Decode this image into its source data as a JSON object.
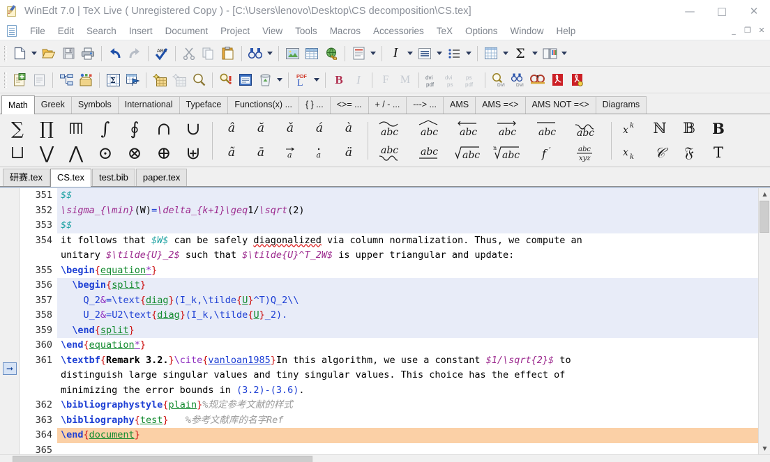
{
  "window": {
    "title": "WinEdt 7.0 | TeX Live  ( Unregistered  Copy )  - [C:\\Users\\lenovo\\Desktop\\CS decomposition\\CS.tex]",
    "app_icon": "winedt-notepad-pencil-icon",
    "minimize": "—",
    "maximize": "□",
    "close": "✕",
    "mdi_minimize": "_",
    "mdi_restore": "❐",
    "mdi_close": "✕"
  },
  "menubar": {
    "doc_icon": "document-icon",
    "items": [
      "File",
      "Edit",
      "Search",
      "Insert",
      "Document",
      "Project",
      "View",
      "Tools",
      "Macros",
      "Accessories",
      "TeX",
      "Options",
      "Window",
      "Help"
    ]
  },
  "toolbar1": [
    {
      "name": "new-document-button",
      "icon": "new-page-icon"
    },
    {
      "name": "new-document-dropdown",
      "icon": "chevron-down-icon"
    },
    {
      "name": "open-button",
      "icon": "open-folder-icon"
    },
    {
      "name": "save-button",
      "icon": "floppy-disk-icon"
    },
    {
      "name": "print-button",
      "icon": "printer-icon"
    },
    {
      "name": "undo-button",
      "icon": "undo-arrow-icon"
    },
    {
      "name": "redo-button",
      "icon": "redo-arrow-icon"
    },
    {
      "name": "spellcheck-button",
      "icon": "abc-check-icon"
    },
    {
      "name": "cut-button",
      "icon": "scissors-icon"
    },
    {
      "name": "copy-button",
      "icon": "copy-pages-icon"
    },
    {
      "name": "paste-button",
      "icon": "clipboard-paste-icon"
    },
    {
      "name": "find-button",
      "icon": "binoculars-icon"
    },
    {
      "name": "find-dropdown",
      "icon": "chevron-down-icon"
    },
    {
      "name": "insert-image-button",
      "icon": "picture-icon"
    },
    {
      "name": "insert-table-button",
      "icon": "table-grid-icon"
    },
    {
      "name": "insert-url-button",
      "icon": "globe-link-icon"
    },
    {
      "name": "document-template-button",
      "icon": "document-red-icon"
    },
    {
      "name": "document-template-dropdown",
      "icon": "chevron-down-icon"
    },
    {
      "name": "italic-button",
      "icon": "italic-I-icon"
    },
    {
      "name": "italic-dropdown",
      "icon": "chevron-down-icon"
    },
    {
      "name": "align-button",
      "icon": "align-paragraph-icon"
    },
    {
      "name": "align-dropdown",
      "icon": "chevron-down-icon"
    },
    {
      "name": "list-button",
      "icon": "bullet-list-icon"
    },
    {
      "name": "list-dropdown",
      "icon": "chevron-down-icon"
    },
    {
      "name": "tabular-button",
      "icon": "tabular-grid-icon"
    },
    {
      "name": "tabular-dropdown",
      "icon": "chevron-down-icon"
    },
    {
      "name": "math-sigma-button",
      "icon": "sigma-icon"
    },
    {
      "name": "math-sigma-dropdown",
      "icon": "chevron-down-icon"
    },
    {
      "name": "book-button",
      "icon": "open-book-icon"
    },
    {
      "name": "book-dropdown",
      "icon": "chevron-down-icon"
    }
  ],
  "toolbar2": [
    {
      "name": "project-open-button",
      "icon": "project-green-plus-icon"
    },
    {
      "name": "project-close-button",
      "icon": "project-gray-icon"
    },
    {
      "name": "tree-structure-button",
      "icon": "tree-nodes-icon"
    },
    {
      "name": "package-button",
      "icon": "toolbox-icon"
    },
    {
      "name": "latex-matrix-button",
      "icon": "sigma-grid-icon"
    },
    {
      "name": "latex-wizard-button",
      "icon": "grid-flag-icon"
    },
    {
      "name": "build-button",
      "icon": "sparkle-grid-icon"
    },
    {
      "name": "build-gray-button",
      "icon": "gray-grid-icon"
    },
    {
      "name": "preview-button",
      "icon": "magnifier-icon"
    },
    {
      "name": "error-find-button",
      "icon": "magnifier-exclaim-icon"
    },
    {
      "name": "console-button",
      "icon": "blue-window-icon"
    },
    {
      "name": "cleanup-button",
      "icon": "trash-recycle-icon"
    },
    {
      "name": "cleanup-dropdown",
      "icon": "chevron-down-icon"
    },
    {
      "name": "pdflatex-button",
      "icon": "pdf-L-icon"
    },
    {
      "name": "pdflatex-dropdown",
      "icon": "chevron-down-icon"
    },
    {
      "name": "bibtex-button",
      "icon": "bold-B-icon"
    },
    {
      "name": "makeindex-button",
      "icon": "italic-I-gray-icon"
    },
    {
      "name": "f-button",
      "icon": "F-gray-icon"
    },
    {
      "name": "m-button",
      "icon": "M-gray-icon"
    },
    {
      "name": "dvi-pdf-button",
      "icon": "dvi-pdf-icon"
    },
    {
      "name": "dvi-ps-button",
      "icon": "dvi-ps-icon"
    },
    {
      "name": "ps-pdf-button",
      "icon": "ps-pdf-icon"
    },
    {
      "name": "preview-dvi-button",
      "icon": "magnifier-dvi-icon"
    },
    {
      "name": "search-dvi-button",
      "icon": "binoculars-dvi-icon"
    },
    {
      "name": "ghostview-button",
      "icon": "ghostscript-icon"
    },
    {
      "name": "acrobat-button",
      "icon": "acrobat-red-icon"
    },
    {
      "name": "acrobat2-button",
      "icon": "acrobat-red-2-icon"
    }
  ],
  "math_tabs": {
    "active": "Math",
    "items": [
      "Math",
      "Greek",
      "Symbols",
      "International",
      "Typeface",
      "Functions(x)  ...",
      "{ }  ...",
      "<>=  ...",
      "+ / -  ...",
      "--->  ...",
      "AMS",
      "AMS  =<>",
      "AMS NOT =<>",
      "Diagrams"
    ]
  },
  "palette": {
    "group1_row1": [
      "∑",
      "∏",
      "⨆",
      "∫",
      "∮",
      "∩",
      "∪"
    ],
    "group1_row2": [
      "⨆",
      "⋁",
      "⋀",
      "⊙",
      "⊗",
      "⊕",
      "⊎"
    ],
    "group1_row1_names": [
      "sum-icon",
      "prod-icon",
      "coprod-icon",
      "int-icon",
      "oint-icon",
      "cap-icon",
      "cup-icon"
    ],
    "group1_row2_names": [
      "bigsqcup-icon",
      "vee-icon",
      "wedge-icon",
      "odot-icon",
      "otimes-icon",
      "oplus-icon",
      "uplus-icon"
    ],
    "group2_row1": [
      "â",
      "ă",
      "ǎ",
      "á",
      "à"
    ],
    "group2_row2": [
      "ã",
      "ā",
      "⃗a",
      "ȧ",
      "ä"
    ],
    "group2_row1_names": [
      "hat-a-icon",
      "breve-a-icon",
      "check-a-icon",
      "acute-a-icon",
      "grave-a-icon"
    ],
    "group2_row2_names": [
      "tilde-a-icon",
      "bar-a-icon",
      "vec-a-icon",
      "dot-a-icon",
      "ddot-a-icon"
    ],
    "group3_row1_names": [
      "widetilde-abc-icon",
      "widehat-abc-icon",
      "overleftarrow-abc-icon",
      "overrightarrow-abc-icon",
      "overline-abc-icon",
      "overbrace-abc-icon"
    ],
    "group3_row2_names": [
      "underbrace-abc-icon",
      "underline-abc-icon",
      "sqrt-abc-icon",
      "nthroot-abc-icon",
      "prime-f-icon",
      "frac-abc-xyz-icon"
    ],
    "group3_row1_labels": [
      "abc",
      "abc",
      "abc",
      "abc",
      "abc",
      "abc"
    ],
    "group3_row2_labels": [
      "abc",
      "abc",
      "abc",
      "abc",
      "f′",
      "abc/xyz"
    ],
    "group4_row1": [
      "xᵏ",
      "ℕ",
      "𝔹",
      "B"
    ],
    "group4_row2": [
      "xₖ",
      "𝒞",
      "𝔉",
      "T"
    ],
    "group4_row1_names": [
      "superscript-icon",
      "blackboard-N-icon",
      "blackboard-B-icon",
      "bold-B-icon"
    ],
    "group4_row2_names": [
      "subscript-icon",
      "calligraphic-C-icon",
      "fraktur-F-icon",
      "roman-T-icon"
    ]
  },
  "file_tabs": {
    "active": "CS.tex",
    "items": [
      "研赛.tex",
      "CS.tex",
      "test.bib",
      "paper.tex"
    ]
  },
  "editor": {
    "bookmark_icon": "go-to-arrow-icon",
    "lines": [
      {
        "number": "351",
        "highlight": "block",
        "spans": [
          {
            "t": "$$",
            "c": "k-dollar"
          }
        ]
      },
      {
        "number": "352",
        "highlight": "block",
        "spans": [
          {
            "t": "\\sigma_{\\min}",
            "c": "k-mathtxt"
          },
          {
            "t": "(W)",
            "c": ""
          },
          {
            "t": "=",
            "c": "k-blue"
          },
          {
            "t": "\\delta_{k+1}",
            "c": "k-mathtxt"
          },
          {
            "t": "\\geq",
            "c": "k-mathtxt"
          },
          {
            "t": "1/",
            "c": ""
          },
          {
            "t": "\\sqrt",
            "c": "k-mathtxt"
          },
          {
            "t": "(2)",
            "c": ""
          }
        ]
      },
      {
        "number": "353",
        "highlight": "block",
        "spans": [
          {
            "t": "$$",
            "c": "k-dollar"
          }
        ]
      },
      {
        "number": "354",
        "highlight": "none",
        "spans": [
          {
            "t": "it follows that ",
            "c": ""
          },
          {
            "t": "$W$",
            "c": "k-dollar"
          },
          {
            "t": " can be safely ",
            "c": ""
          },
          {
            "t": "diagonalized",
            "c": "misspell"
          },
          {
            "t": " via column normalization. Thus, we compute an",
            "c": ""
          }
        ]
      },
      {
        "number": "",
        "highlight": "none",
        "spans": [
          {
            "t": "unitary ",
            "c": ""
          },
          {
            "t": "$\\tilde{U}_2$",
            "c": "k-mathtxt"
          },
          {
            "t": " such that ",
            "c": ""
          },
          {
            "t": "$\\tilde{U}^T_2W$",
            "c": "k-mathtxt"
          },
          {
            "t": " is upper triangular and update:",
            "c": ""
          }
        ]
      },
      {
        "number": "355",
        "highlight": "none",
        "spans": [
          {
            "t": "\\begin",
            "c": "k-cmd"
          },
          {
            "t": "{",
            "c": "k-brace"
          },
          {
            "t": "equation",
            "c": "k-env"
          },
          {
            "t": "*",
            "c": "k-star"
          },
          {
            "t": "}",
            "c": "k-brace"
          }
        ]
      },
      {
        "number": "356",
        "highlight": "block",
        "spans": [
          {
            "t": "  ",
            "c": ""
          },
          {
            "t": "\\begin",
            "c": "k-cmd"
          },
          {
            "t": "{",
            "c": "k-brace"
          },
          {
            "t": "split",
            "c": "k-env"
          },
          {
            "t": "}",
            "c": "k-brace"
          }
        ]
      },
      {
        "number": "357",
        "highlight": "block",
        "spans": [
          {
            "t": "    Q_2",
            "c": "k-blue"
          },
          {
            "t": "&",
            "c": "k-purple"
          },
          {
            "t": "=",
            "c": "k-blue"
          },
          {
            "t": "\\text",
            "c": "k-cmd2"
          },
          {
            "t": "{",
            "c": "k-brace"
          },
          {
            "t": "diag",
            "c": "k-env"
          },
          {
            "t": "}",
            "c": "k-brace"
          },
          {
            "t": "(I_k,",
            "c": "k-blue"
          },
          {
            "t": "\\tilde",
            "c": "k-cmd2"
          },
          {
            "t": "{",
            "c": "k-brace"
          },
          {
            "t": "U",
            "c": "k-env"
          },
          {
            "t": "}",
            "c": "k-brace"
          },
          {
            "t": "^T)Q_2\\\\",
            "c": "k-blue"
          }
        ]
      },
      {
        "number": "358",
        "highlight": "block",
        "spans": [
          {
            "t": "    U_2",
            "c": "k-blue"
          },
          {
            "t": "&",
            "c": "k-purple"
          },
          {
            "t": "=",
            "c": "k-blue"
          },
          {
            "t": "U2",
            "c": "k-blue"
          },
          {
            "t": "\\text",
            "c": "k-cmd2"
          },
          {
            "t": "{",
            "c": "k-brace"
          },
          {
            "t": "diag",
            "c": "k-env"
          },
          {
            "t": "}",
            "c": "k-brace"
          },
          {
            "t": "(I_k,",
            "c": "k-blue"
          },
          {
            "t": "\\tilde",
            "c": "k-cmd2"
          },
          {
            "t": "{",
            "c": "k-brace"
          },
          {
            "t": "U",
            "c": "k-env"
          },
          {
            "t": "}",
            "c": "k-brace"
          },
          {
            "t": "_2).",
            "c": "k-blue"
          }
        ]
      },
      {
        "number": "359",
        "highlight": "block",
        "spans": [
          {
            "t": "  ",
            "c": ""
          },
          {
            "t": "\\end",
            "c": "k-cmd"
          },
          {
            "t": "{",
            "c": "k-brace"
          },
          {
            "t": "split",
            "c": "k-env"
          },
          {
            "t": "}",
            "c": "k-brace"
          }
        ]
      },
      {
        "number": "360",
        "highlight": "none",
        "spans": [
          {
            "t": "\\end",
            "c": "k-cmd"
          },
          {
            "t": "{",
            "c": "k-brace"
          },
          {
            "t": "equation",
            "c": "k-env"
          },
          {
            "t": "*",
            "c": "k-star"
          },
          {
            "t": "}",
            "c": "k-brace"
          }
        ]
      },
      {
        "number": "361",
        "highlight": "none",
        "spans": [
          {
            "t": "\\textbf",
            "c": "k-cmd"
          },
          {
            "t": "{",
            "c": "k-brace"
          },
          {
            "t": "Remark 3.2.",
            "c": "k-bold"
          },
          {
            "t": "}",
            "c": "k-brace"
          },
          {
            "t": "\\cite",
            "c": "k-purple"
          },
          {
            "t": "{",
            "c": "k-brace"
          },
          {
            "t": "vanloan1985",
            "c": "k-cite"
          },
          {
            "t": "}",
            "c": "k-brace"
          },
          {
            "t": "In this algorithm, we use a constant ",
            "c": ""
          },
          {
            "t": "$1/\\sqrt{2}$",
            "c": "k-mathtxt"
          },
          {
            "t": " to",
            "c": ""
          }
        ]
      },
      {
        "number": "",
        "highlight": "none",
        "spans": [
          {
            "t": "distinguish large singular values and tiny singular values. This choice has the effect of",
            "c": ""
          }
        ]
      },
      {
        "number": "",
        "highlight": "none",
        "spans": [
          {
            "t": "minimizing the error bounds in ",
            "c": ""
          },
          {
            "t": "(3.2)-(3.6)",
            "c": "k-blue"
          },
          {
            "t": ".",
            "c": ""
          }
        ]
      },
      {
        "number": "362",
        "highlight": "none",
        "spans": [
          {
            "t": "\\bibliographystyle",
            "c": "k-cmd"
          },
          {
            "t": "{",
            "c": "k-brace"
          },
          {
            "t": "plain",
            "c": "k-env"
          },
          {
            "t": "}",
            "c": "k-brace"
          },
          {
            "t": "%规定参考文献的样式",
            "c": "k-comment"
          }
        ]
      },
      {
        "number": "363",
        "highlight": "none",
        "spans": [
          {
            "t": "\\bibliography",
            "c": "k-cmd"
          },
          {
            "t": "{",
            "c": "k-brace"
          },
          {
            "t": "test",
            "c": "k-env"
          },
          {
            "t": "}",
            "c": "k-brace"
          },
          {
            "t": "   %参考文献库的名字Ref",
            "c": "k-comment"
          }
        ]
      },
      {
        "number": "364",
        "highlight": "current",
        "spans": [
          {
            "t": "\\end",
            "c": "k-cmd"
          },
          {
            "t": "{",
            "c": "k-brace"
          },
          {
            "t": "document",
            "c": "k-env"
          },
          {
            "t": "}",
            "c": "k-brace"
          }
        ]
      },
      {
        "number": "365",
        "highlight": "none",
        "spans": []
      }
    ]
  },
  "scrollbars": {
    "v_up": "▲",
    "v_down": "▼"
  },
  "colors": {
    "accent_blue": "#1d3fd4",
    "env_green": "#128a2e",
    "brace_red": "#cc1111",
    "math_teal": "#19a0a0",
    "math_magenta": "#9c2a8e",
    "current_line": "#fbd0a6",
    "block_highlight": "#e8ecf8",
    "toolbar_bg": "#f1f1f1",
    "title_gray": "#8a8f98"
  }
}
